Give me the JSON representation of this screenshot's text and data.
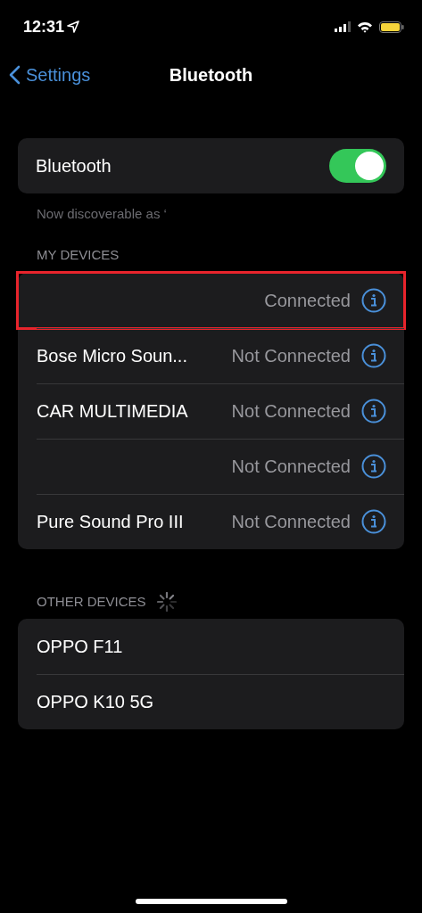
{
  "status_bar": {
    "time": "12:31"
  },
  "nav": {
    "back": "Settings",
    "title": "Bluetooth"
  },
  "bluetooth": {
    "label": "Bluetooth",
    "on": true,
    "caption": "Now discoverable as ‘"
  },
  "my_devices": {
    "header": "MY DEVICES",
    "items": [
      {
        "status": "Connected",
        "highlighted": true
      },
      {
        "name": "Bose Micro Soun...",
        "status": "Not Connected",
        "highlighted": false
      },
      {
        "name": "CAR MULTIMEDIA",
        "status": "Not Connected",
        "highlighted": false
      },
      {
        "status": "Not Connected",
        "highlighted": false
      },
      {
        "name": "Pure Sound Pro III",
        "status": "Not Connected",
        "highlighted": false
      }
    ]
  },
  "other_devices": {
    "header": "OTHER DEVICES",
    "searching": true,
    "items": [
      {
        "name": "OPPO F11"
      },
      {
        "name": "OPPO K10 5G"
      }
    ]
  }
}
